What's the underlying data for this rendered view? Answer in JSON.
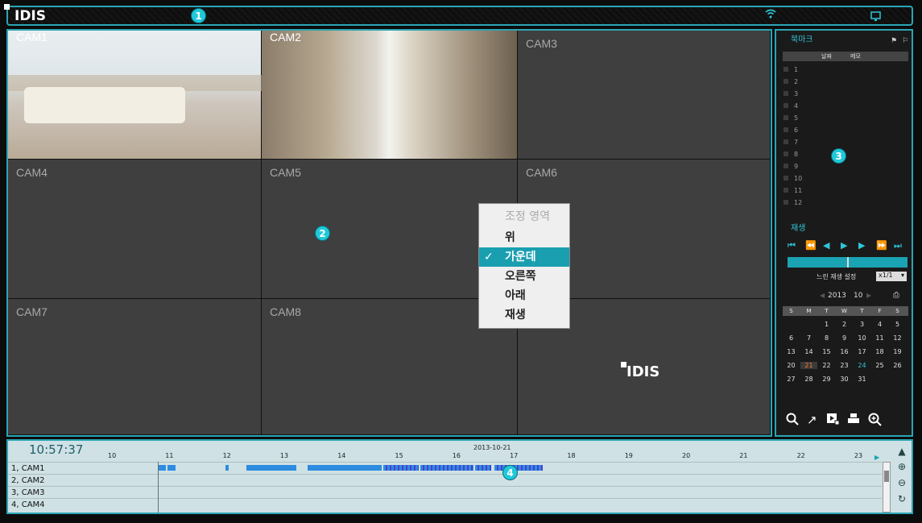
{
  "app": {
    "logo_text": "IDIS"
  },
  "badges": {
    "b1": "1",
    "b2": "2",
    "b3": "3",
    "b4": "4"
  },
  "cameras": [
    "CAM1",
    "CAM2",
    "CAM3",
    "CAM4",
    "CAM5",
    "CAM6",
    "CAM7",
    "CAM8",
    ""
  ],
  "watermark": "IDIS",
  "context_menu": {
    "title": "조정 영역",
    "items": [
      "위",
      "가운데",
      "오른쪽",
      "아래",
      "재생"
    ],
    "selected": "가운데"
  },
  "bookmark": {
    "title": "북마크",
    "col_date": "날짜",
    "col_memo": "메모",
    "rows": [
      "1",
      "2",
      "3",
      "4",
      "5",
      "6",
      "7",
      "8",
      "9",
      "10",
      "11",
      "12"
    ]
  },
  "playback": {
    "title": "재생",
    "slow_label": "느린 재생 설정",
    "slow_value": "x1/1"
  },
  "calendar": {
    "year": "2013",
    "month": "10",
    "weekdays": [
      "S",
      "M",
      "T",
      "W",
      "T",
      "F",
      "S"
    ],
    "weeks": [
      [
        "",
        "",
        "1",
        "2",
        "3",
        "4",
        "5"
      ],
      [
        "6",
        "7",
        "8",
        "9",
        "10",
        "11",
        "12"
      ],
      [
        "13",
        "14",
        "15",
        "16",
        "17",
        "18",
        "19"
      ],
      [
        "20",
        "21",
        "22",
        "23",
        "24",
        "25",
        "26"
      ],
      [
        "27",
        "28",
        "29",
        "30",
        "31",
        "",
        ""
      ]
    ],
    "highlight_orange": "21",
    "highlight_cyan": "24"
  },
  "timeline": {
    "clock": "10:57:37",
    "date": "2013-10-21",
    "hours": [
      "10",
      "11",
      "12",
      "13",
      "14",
      "15",
      "16",
      "17",
      "18",
      "19",
      "20",
      "21",
      "22",
      "23"
    ],
    "rows": [
      "1, CAM1",
      "2, CAM2",
      "3, CAM3",
      "4, CAM4"
    ]
  },
  "colors": {
    "accent": "#2aa5b5",
    "selected": "#1a9fb0",
    "bar": "#2d8ce0"
  },
  "icons": [
    "wifi-icon",
    "monitor-icon",
    "search-icon",
    "export-icon",
    "clip-icon",
    "print-icon",
    "zoom-icon",
    "scroll-up-icon",
    "zoom-in-icon",
    "zoom-out-icon",
    "refresh-icon"
  ]
}
